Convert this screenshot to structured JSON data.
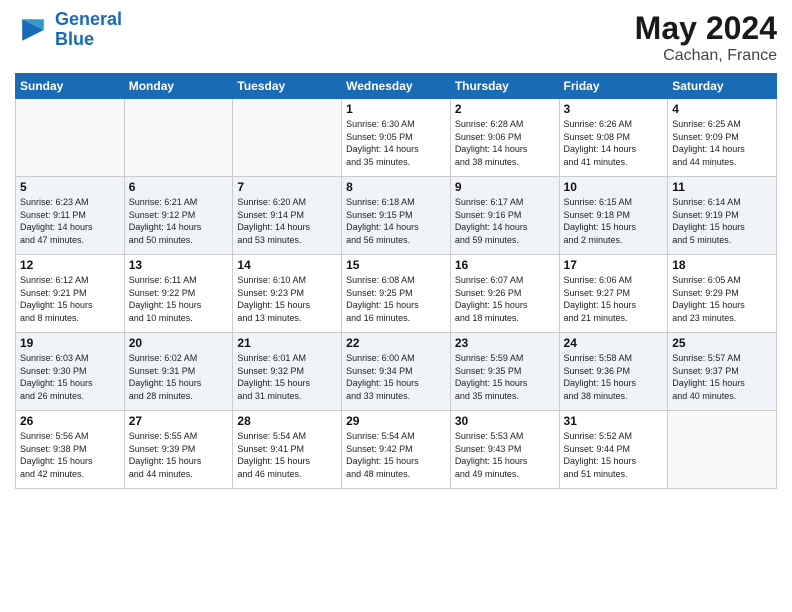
{
  "header": {
    "logo_line1": "General",
    "logo_line2": "Blue",
    "month": "May 2024",
    "location": "Cachan, France"
  },
  "weekdays": [
    "Sunday",
    "Monday",
    "Tuesday",
    "Wednesday",
    "Thursday",
    "Friday",
    "Saturday"
  ],
  "weeks": [
    [
      {
        "day": "",
        "info": ""
      },
      {
        "day": "",
        "info": ""
      },
      {
        "day": "",
        "info": ""
      },
      {
        "day": "1",
        "info": "Sunrise: 6:30 AM\nSunset: 9:05 PM\nDaylight: 14 hours\nand 35 minutes."
      },
      {
        "day": "2",
        "info": "Sunrise: 6:28 AM\nSunset: 9:06 PM\nDaylight: 14 hours\nand 38 minutes."
      },
      {
        "day": "3",
        "info": "Sunrise: 6:26 AM\nSunset: 9:08 PM\nDaylight: 14 hours\nand 41 minutes."
      },
      {
        "day": "4",
        "info": "Sunrise: 6:25 AM\nSunset: 9:09 PM\nDaylight: 14 hours\nand 44 minutes."
      }
    ],
    [
      {
        "day": "5",
        "info": "Sunrise: 6:23 AM\nSunset: 9:11 PM\nDaylight: 14 hours\nand 47 minutes."
      },
      {
        "day": "6",
        "info": "Sunrise: 6:21 AM\nSunset: 9:12 PM\nDaylight: 14 hours\nand 50 minutes."
      },
      {
        "day": "7",
        "info": "Sunrise: 6:20 AM\nSunset: 9:14 PM\nDaylight: 14 hours\nand 53 minutes."
      },
      {
        "day": "8",
        "info": "Sunrise: 6:18 AM\nSunset: 9:15 PM\nDaylight: 14 hours\nand 56 minutes."
      },
      {
        "day": "9",
        "info": "Sunrise: 6:17 AM\nSunset: 9:16 PM\nDaylight: 14 hours\nand 59 minutes."
      },
      {
        "day": "10",
        "info": "Sunrise: 6:15 AM\nSunset: 9:18 PM\nDaylight: 15 hours\nand 2 minutes."
      },
      {
        "day": "11",
        "info": "Sunrise: 6:14 AM\nSunset: 9:19 PM\nDaylight: 15 hours\nand 5 minutes."
      }
    ],
    [
      {
        "day": "12",
        "info": "Sunrise: 6:12 AM\nSunset: 9:21 PM\nDaylight: 15 hours\nand 8 minutes."
      },
      {
        "day": "13",
        "info": "Sunrise: 6:11 AM\nSunset: 9:22 PM\nDaylight: 15 hours\nand 10 minutes."
      },
      {
        "day": "14",
        "info": "Sunrise: 6:10 AM\nSunset: 9:23 PM\nDaylight: 15 hours\nand 13 minutes."
      },
      {
        "day": "15",
        "info": "Sunrise: 6:08 AM\nSunset: 9:25 PM\nDaylight: 15 hours\nand 16 minutes."
      },
      {
        "day": "16",
        "info": "Sunrise: 6:07 AM\nSunset: 9:26 PM\nDaylight: 15 hours\nand 18 minutes."
      },
      {
        "day": "17",
        "info": "Sunrise: 6:06 AM\nSunset: 9:27 PM\nDaylight: 15 hours\nand 21 minutes."
      },
      {
        "day": "18",
        "info": "Sunrise: 6:05 AM\nSunset: 9:29 PM\nDaylight: 15 hours\nand 23 minutes."
      }
    ],
    [
      {
        "day": "19",
        "info": "Sunrise: 6:03 AM\nSunset: 9:30 PM\nDaylight: 15 hours\nand 26 minutes."
      },
      {
        "day": "20",
        "info": "Sunrise: 6:02 AM\nSunset: 9:31 PM\nDaylight: 15 hours\nand 28 minutes."
      },
      {
        "day": "21",
        "info": "Sunrise: 6:01 AM\nSunset: 9:32 PM\nDaylight: 15 hours\nand 31 minutes."
      },
      {
        "day": "22",
        "info": "Sunrise: 6:00 AM\nSunset: 9:34 PM\nDaylight: 15 hours\nand 33 minutes."
      },
      {
        "day": "23",
        "info": "Sunrise: 5:59 AM\nSunset: 9:35 PM\nDaylight: 15 hours\nand 35 minutes."
      },
      {
        "day": "24",
        "info": "Sunrise: 5:58 AM\nSunset: 9:36 PM\nDaylight: 15 hours\nand 38 minutes."
      },
      {
        "day": "25",
        "info": "Sunrise: 5:57 AM\nSunset: 9:37 PM\nDaylight: 15 hours\nand 40 minutes."
      }
    ],
    [
      {
        "day": "26",
        "info": "Sunrise: 5:56 AM\nSunset: 9:38 PM\nDaylight: 15 hours\nand 42 minutes."
      },
      {
        "day": "27",
        "info": "Sunrise: 5:55 AM\nSunset: 9:39 PM\nDaylight: 15 hours\nand 44 minutes."
      },
      {
        "day": "28",
        "info": "Sunrise: 5:54 AM\nSunset: 9:41 PM\nDaylight: 15 hours\nand 46 minutes."
      },
      {
        "day": "29",
        "info": "Sunrise: 5:54 AM\nSunset: 9:42 PM\nDaylight: 15 hours\nand 48 minutes."
      },
      {
        "day": "30",
        "info": "Sunrise: 5:53 AM\nSunset: 9:43 PM\nDaylight: 15 hours\nand 49 minutes."
      },
      {
        "day": "31",
        "info": "Sunrise: 5:52 AM\nSunset: 9:44 PM\nDaylight: 15 hours\nand 51 minutes."
      },
      {
        "day": "",
        "info": ""
      }
    ]
  ]
}
